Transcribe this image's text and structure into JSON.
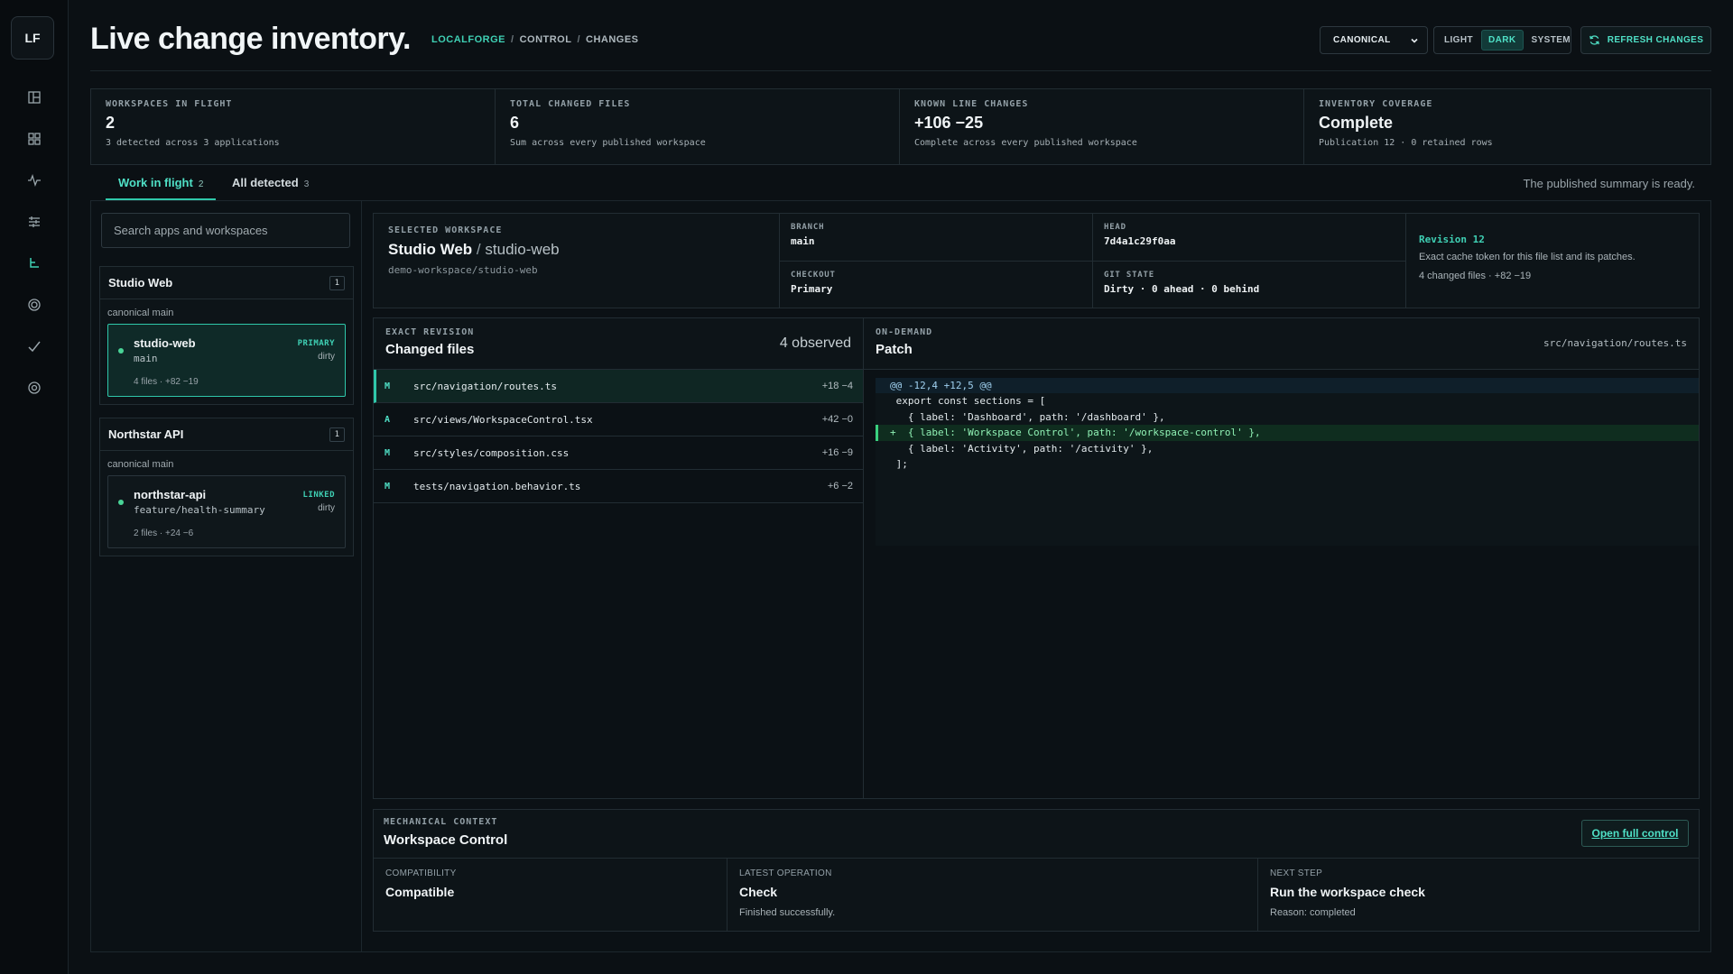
{
  "colors": {
    "accent": "#2fc7aa",
    "background": "#0b1014",
    "add_line": "#3ad07f"
  },
  "sidebar": {
    "logo": "LF",
    "icons": [
      "dashboard-icon",
      "grid-icon",
      "activity-icon",
      "sliders-icon",
      "branch-icon",
      "target-icon",
      "check-icon",
      "settings-icon"
    ]
  },
  "header": {
    "title": "Live change inventory.",
    "breadcrumb": [
      "LOCALFORGE",
      "CONTROL",
      "CHANGES"
    ],
    "select_value": "CANONICAL",
    "theme_options": [
      "LIGHT",
      "DARK",
      "SYSTEM"
    ],
    "theme_selected": "DARK",
    "refresh_label": "REFRESH CHANGES"
  },
  "stats": [
    {
      "label": "WORKSPACES IN FLIGHT",
      "value": "2",
      "sub": "3 detected across 3 applications"
    },
    {
      "label": "TOTAL CHANGED FILES",
      "value": "6",
      "sub": "Sum across every published workspace"
    },
    {
      "label": "KNOWN LINE CHANGES",
      "value": "+106 −25",
      "sub": "Complete across every published workspace"
    },
    {
      "label": "INVENTORY COVERAGE",
      "value": "Complete",
      "sub": "Publication 12 · 0 retained rows"
    }
  ],
  "tabs": [
    {
      "label": "Work in flight",
      "count": "2"
    },
    {
      "label": "All detected",
      "count": "3"
    }
  ],
  "status_message": "The published summary is ready.",
  "search": {
    "placeholder": "Search apps and workspaces"
  },
  "groups": [
    {
      "name": "Studio Web",
      "count": "1",
      "sub": "canonical main",
      "workspace": {
        "name": "studio-web",
        "branch": "main",
        "tag": "PRIMARY",
        "state": "dirty",
        "meta": "4 files · +82 −19"
      }
    },
    {
      "name": "Northstar API",
      "count": "1",
      "sub": "canonical main",
      "workspace": {
        "name": "northstar-api",
        "branch": "feature/health-summary",
        "tag": "LINKED",
        "state": "dirty",
        "meta": "2 files · +24 −6"
      }
    }
  ],
  "selected": {
    "label": "SELECTED WORKSPACE",
    "app": "Studio Web",
    "workspace": "studio-web",
    "path": "demo-workspace/studio-web",
    "branch_label": "BRANCH",
    "branch": "main",
    "head_label": "HEAD",
    "head": "7d4a1c29f0aa",
    "checkout_label": "CHECKOUT",
    "checkout": "Primary",
    "git_label": "GIT STATE",
    "git": "Dirty · 0 ahead · 0 behind",
    "revision": "Revision 12",
    "revision_desc": "Exact cache token for this file list and its patches.",
    "revision_meta": "4 changed files · +82 −19"
  },
  "files": {
    "label": "EXACT REVISION",
    "title": "Changed files",
    "count": "4 observed",
    "rows": [
      {
        "status": "M",
        "path": "src/navigation/routes.ts",
        "delta": "+18 −4"
      },
      {
        "status": "A",
        "path": "src/views/WorkspaceControl.tsx",
        "delta": "+42 −0"
      },
      {
        "status": "M",
        "path": "src/styles/composition.css",
        "delta": "+16 −9"
      },
      {
        "status": "M",
        "path": "tests/navigation.behavior.ts",
        "delta": "+6 −2"
      }
    ]
  },
  "patch": {
    "label": "ON-DEMAND",
    "title": "Patch",
    "file": "src/navigation/routes.ts",
    "lines": [
      {
        "kind": "hunk",
        "text": "@@ -12,4 +12,5 @@"
      },
      {
        "kind": "ctx",
        "text": " export const sections = ["
      },
      {
        "kind": "ctx",
        "text": "   { label: 'Dashboard', path: '/dashboard' },"
      },
      {
        "kind": "add",
        "text": "+  { label: 'Workspace Control', path: '/workspace-control' },"
      },
      {
        "kind": "ctx",
        "text": "   { label: 'Activity', path: '/activity' },"
      },
      {
        "kind": "ctx",
        "text": " ];"
      }
    ]
  },
  "mechanical": {
    "label": "MECHANICAL CONTEXT",
    "title": "Workspace Control",
    "button": "Open full control",
    "cells": [
      {
        "label": "COMPATIBILITY",
        "value": "Compatible",
        "sub": ""
      },
      {
        "label": "LATEST OPERATION",
        "value": "Check",
        "sub": "Finished successfully."
      },
      {
        "label": "NEXT STEP",
        "value": "Run the workspace check",
        "sub": "Reason: completed"
      }
    ]
  }
}
